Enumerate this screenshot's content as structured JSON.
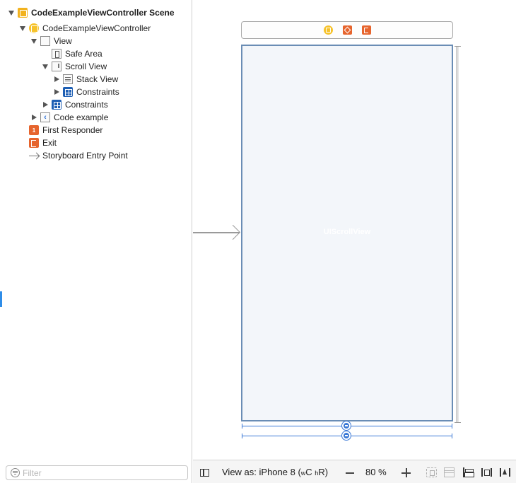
{
  "outline": {
    "items": [
      {
        "label": "CodeExampleViewController Scene",
        "icon": "scene-icon",
        "state": "open",
        "bold": true
      },
      {
        "label": "CodeExampleViewController",
        "icon": "view-controller-icon",
        "state": "open"
      },
      {
        "label": "View",
        "icon": "view-icon",
        "state": "open"
      },
      {
        "label": "Safe Area",
        "icon": "safe-area-icon",
        "state": "none"
      },
      {
        "label": "Scroll View",
        "icon": "scroll-view-icon",
        "state": "open"
      },
      {
        "label": "Stack View",
        "icon": "stack-view-icon",
        "state": "closed"
      },
      {
        "label": "Constraints",
        "icon": "constraints-icon",
        "state": "closed"
      },
      {
        "label": "Constraints",
        "icon": "constraints-icon",
        "state": "closed"
      },
      {
        "label": "Code example",
        "icon": "back-button-icon",
        "state": "closed"
      },
      {
        "label": "First Responder",
        "icon": "first-responder-icon",
        "state": "none"
      },
      {
        "label": "Exit",
        "icon": "exit-icon",
        "state": "none"
      },
      {
        "label": "Storyboard Entry Point",
        "icon": "entry-point-icon",
        "state": "none"
      }
    ],
    "filter": {
      "placeholder": "Filter",
      "value": ""
    }
  },
  "canvas": {
    "dock_icons": [
      "view-controller-icon",
      "first-responder-icon",
      "exit-icon"
    ],
    "view_label": "UIScrollView"
  },
  "bottom_bar": {
    "view_as_prefix": "View as: iPhone 8 (",
    "width_class_letter": "w",
    "width_class": "C",
    "height_class_letter": "h",
    "height_class": "R",
    "view_as_suffix": ")",
    "zoom": "80 %"
  },
  "colors": {
    "accent": "#3a78d6",
    "frame_border": "#6a8db5",
    "frame_fill": "#f3f6fa",
    "scene_icon": "#f2b21e",
    "responder_icon": "#e6642d",
    "constraints_icon": "#1e5fb4"
  }
}
